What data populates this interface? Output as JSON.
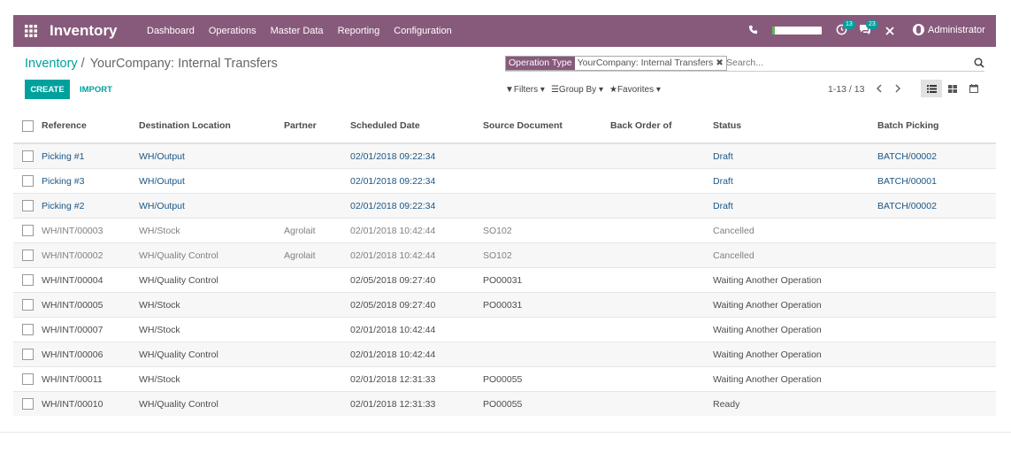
{
  "navbar": {
    "app_name": "Inventory",
    "menu": [
      "Dashboard",
      "Operations",
      "Master Data",
      "Reporting",
      "Configuration"
    ],
    "activity_count": "13",
    "messages_count": "23",
    "user_name": "Administrator",
    "progress_fraction": 0.06,
    "bg_color": "#875a7b"
  },
  "breadcrumb": {
    "parent": "Inventory",
    "separator": "/",
    "current": "YourCompany: Internal Transfers"
  },
  "search": {
    "facet_label": "Operation Type",
    "facet_value": "YourCompany: Internal Transfers",
    "placeholder": "Search..."
  },
  "buttons": {
    "create": "CREATE",
    "import": "IMPORT"
  },
  "filters": {
    "filters": "Filters",
    "group_by": "Group By",
    "favorites": "Favorites"
  },
  "pager": {
    "value": "1-13 / 13"
  },
  "table": {
    "headers": [
      "Reference",
      "Destination Location",
      "Partner",
      "Scheduled Date",
      "Source Document",
      "Back Order of",
      "Status",
      "Batch Picking"
    ],
    "rows": [
      {
        "ref": "Picking #1",
        "dest": "WH/Output",
        "partner": "",
        "date": "02/01/2018 09:22:34",
        "source": "",
        "backorder": "",
        "status": "Draft",
        "batch": "BATCH/00002",
        "state": "draft"
      },
      {
        "ref": "Picking #3",
        "dest": "WH/Output",
        "partner": "",
        "date": "02/01/2018 09:22:34",
        "source": "",
        "backorder": "",
        "status": "Draft",
        "batch": "BATCH/00001",
        "state": "draft"
      },
      {
        "ref": "Picking #2",
        "dest": "WH/Output",
        "partner": "",
        "date": "02/01/2018 09:22:34",
        "source": "",
        "backorder": "",
        "status": "Draft",
        "batch": "BATCH/00002",
        "state": "draft"
      },
      {
        "ref": "WH/INT/00003",
        "dest": "WH/Stock",
        "partner": "Agrolait",
        "date": "02/01/2018 10:42:44",
        "source": "SO102",
        "backorder": "",
        "status": "Cancelled",
        "batch": "",
        "state": "cancel"
      },
      {
        "ref": "WH/INT/00002",
        "dest": "WH/Quality Control",
        "partner": "Agrolait",
        "date": "02/01/2018 10:42:44",
        "source": "SO102",
        "backorder": "",
        "status": "Cancelled",
        "batch": "",
        "state": "cancel"
      },
      {
        "ref": "WH/INT/00004",
        "dest": "WH/Quality Control",
        "partner": "",
        "date": "02/05/2018 09:27:40",
        "source": "PO00031",
        "backorder": "",
        "status": "Waiting Another Operation",
        "batch": "",
        "state": "waiting"
      },
      {
        "ref": "WH/INT/00005",
        "dest": "WH/Stock",
        "partner": "",
        "date": "02/05/2018 09:27:40",
        "source": "PO00031",
        "backorder": "",
        "status": "Waiting Another Operation",
        "batch": "",
        "state": "waiting"
      },
      {
        "ref": "WH/INT/00007",
        "dest": "WH/Stock",
        "partner": "",
        "date": "02/01/2018 10:42:44",
        "source": "",
        "backorder": "",
        "status": "Waiting Another Operation",
        "batch": "",
        "state": "waiting"
      },
      {
        "ref": "WH/INT/00006",
        "dest": "WH/Quality Control",
        "partner": "",
        "date": "02/01/2018 10:42:44",
        "source": "",
        "backorder": "",
        "status": "Waiting Another Operation",
        "batch": "",
        "state": "waiting"
      },
      {
        "ref": "WH/INT/00011",
        "dest": "WH/Stock",
        "partner": "",
        "date": "02/01/2018 12:31:33",
        "source": "PO00055",
        "backorder": "",
        "status": "Waiting Another Operation",
        "batch": "",
        "state": "waiting"
      },
      {
        "ref": "WH/INT/00010",
        "dest": "WH/Quality Control",
        "partner": "",
        "date": "02/01/2018 12:31:33",
        "source": "PO00055",
        "backorder": "",
        "status": "Ready",
        "batch": "",
        "state": "ready"
      }
    ]
  },
  "colors": {
    "accent": "#00a09d",
    "brand": "#875a7b",
    "link": "#1b5685",
    "muted": "#808080"
  }
}
